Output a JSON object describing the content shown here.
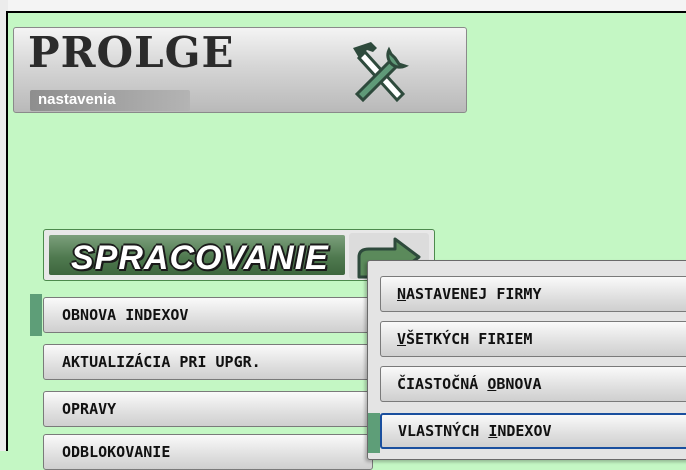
{
  "logo": {
    "title": "PROLGE",
    "subtitle": "nastavenia",
    "icon": "tools-icon"
  },
  "section": {
    "title": "SPRACOVANIE",
    "icon": "arrow-turn-right-icon"
  },
  "menu": {
    "items": [
      {
        "label": "OBNOVA INDEXOV"
      },
      {
        "label": "AKTUALIZÁCIA PRI UPGR."
      },
      {
        "label": "OPRAVY"
      },
      {
        "label": "ODBLOKOVANIE"
      }
    ]
  },
  "submenu": {
    "items": [
      {
        "hotkey": "N",
        "rest": "ASTAVENEJ FIRMY"
      },
      {
        "hotkey": "V",
        "rest": "ŠETKÝCH FIRIEM"
      },
      {
        "prefix": "ČIASTOČNÁ ",
        "hotkey": "O",
        "rest": "BNOVA"
      },
      {
        "prefix": "VLASTNÝCH ",
        "hotkey": "I",
        "rest": "NDEXOV"
      }
    ]
  },
  "colors": {
    "background": "#c4f7c4",
    "accent": "#5e9e78",
    "focus_border": "#1a4f9e"
  }
}
